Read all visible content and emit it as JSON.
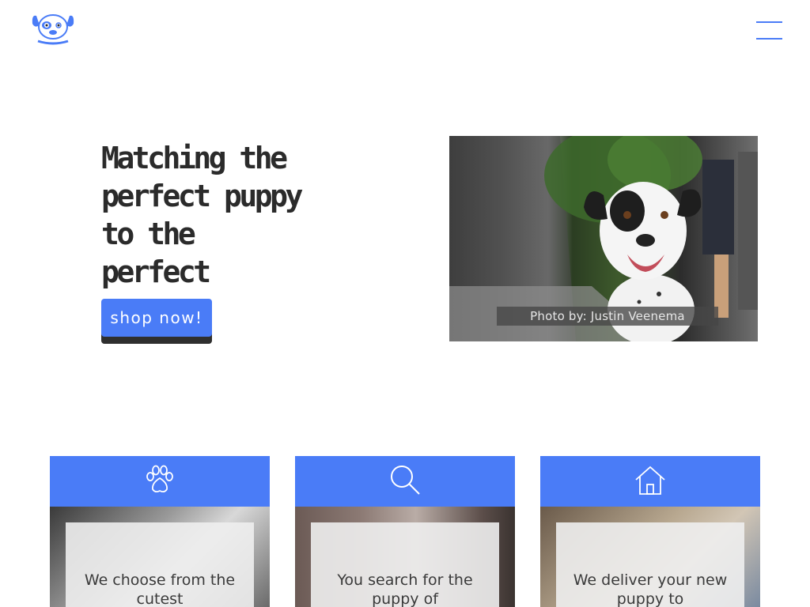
{
  "header": {
    "logo_icon": "puppy-face-logo",
    "menu_icon": "hamburger-menu-icon",
    "accent_color": "#4a7cf7"
  },
  "hero": {
    "headline": "Matching the perfect puppy to the perfect owner.",
    "cta_label": "shop now!",
    "photo_caption": "Photo by: Justin Veenema",
    "photo_subject": "smiling black-and-white dog on a sidewalk"
  },
  "features": [
    {
      "icon": "paw-icon",
      "text": "We choose from the cutest"
    },
    {
      "icon": "search-icon",
      "text": "You search for the puppy of"
    },
    {
      "icon": "home-icon",
      "text": "We deliver your new puppy to"
    }
  ],
  "colors": {
    "accent": "#4a7cf7",
    "headline": "#2b2b2b",
    "button_shadow": "#2f2f2f"
  }
}
